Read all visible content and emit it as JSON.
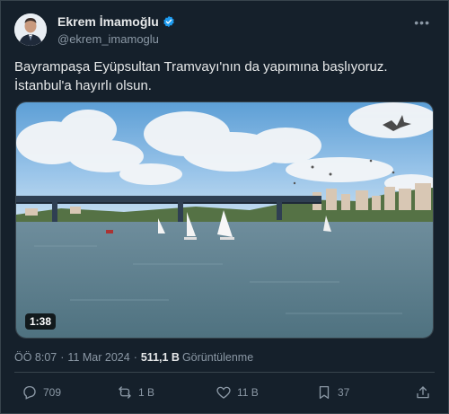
{
  "author": {
    "display_name": "Ekrem İmamoğlu",
    "handle": "@ekrem_imamoglu",
    "verified": true
  },
  "tweet": {
    "text": "Bayrampaşa Eyüpsultan Tramvayı'nın da yapımına başlıyoruz. İstanbul'a hayırlı olsun."
  },
  "media": {
    "type": "video",
    "duration": "1:38"
  },
  "meta": {
    "time": "ÖÖ 8:07",
    "separator": "·",
    "date": "11 Mar 2024",
    "views_count": "511,1 B",
    "views_label": "Görüntülenme"
  },
  "actions": {
    "reply_count": "709",
    "retweet_count": "1 B",
    "like_count": "11 B",
    "bookmark_count": "37"
  },
  "colors": {
    "background": "#15202b",
    "accent_blue": "#1d9bf0",
    "secondary_text": "#8b98a5"
  }
}
